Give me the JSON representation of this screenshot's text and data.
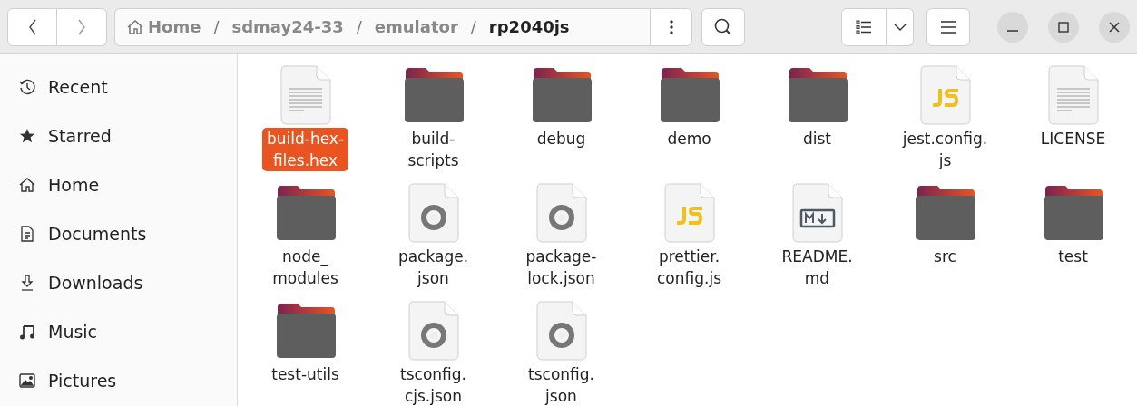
{
  "path": [
    {
      "label": "Home",
      "selected": false
    },
    {
      "label": "sdmay24-33",
      "selected": false
    },
    {
      "label": "emulator",
      "selected": false
    },
    {
      "label": "rp2040js",
      "selected": true
    }
  ],
  "separator": "/",
  "sidebar": {
    "items": [
      {
        "label": "Recent"
      },
      {
        "label": "Starred"
      },
      {
        "label": "Home"
      },
      {
        "label": "Documents"
      },
      {
        "label": "Downloads"
      },
      {
        "label": "Music"
      },
      {
        "label": "Pictures"
      }
    ]
  },
  "files": [
    {
      "kind": "text",
      "lines": [
        "build-hex-",
        "files.hex"
      ],
      "selected": true
    },
    {
      "kind": "folder",
      "lines": [
        "build-",
        "scripts"
      ],
      "selected": false
    },
    {
      "kind": "folder",
      "lines": [
        "debug"
      ],
      "selected": false
    },
    {
      "kind": "folder",
      "lines": [
        "demo"
      ],
      "selected": false
    },
    {
      "kind": "folder",
      "lines": [
        "dist"
      ],
      "selected": false
    },
    {
      "kind": "js",
      "lines": [
        "jest.config.",
        "js"
      ],
      "selected": false
    },
    {
      "kind": "text",
      "lines": [
        "LICENSE"
      ],
      "selected": false
    },
    {
      "kind": "folder",
      "lines": [
        "node_",
        "modules"
      ],
      "selected": false
    },
    {
      "kind": "json",
      "lines": [
        "package.",
        "json"
      ],
      "selected": false
    },
    {
      "kind": "json",
      "lines": [
        "package-",
        "lock.json"
      ],
      "selected": false
    },
    {
      "kind": "js",
      "lines": [
        "prettier.",
        "config.js"
      ],
      "selected": false
    },
    {
      "kind": "markdown",
      "lines": [
        "README.",
        "md"
      ],
      "selected": false
    },
    {
      "kind": "folder",
      "lines": [
        "src"
      ],
      "selected": false
    },
    {
      "kind": "folder",
      "lines": [
        "test"
      ],
      "selected": false
    },
    {
      "kind": "folder",
      "lines": [
        "test-utils"
      ],
      "selected": false
    },
    {
      "kind": "json",
      "lines": [
        "tsconfig.",
        "cjs.json"
      ],
      "selected": false
    },
    {
      "kind": "json",
      "lines": [
        "tsconfig.",
        "json"
      ],
      "selected": false
    }
  ]
}
